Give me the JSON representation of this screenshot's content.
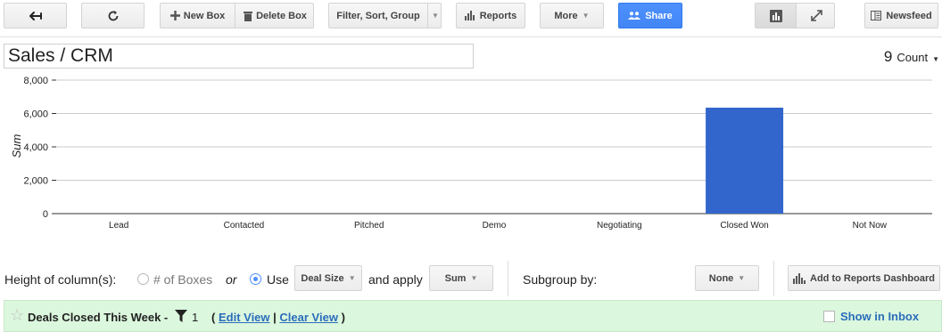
{
  "toolbar": {
    "back_icon": "arrow-left-icon",
    "refresh_icon": "refresh-icon",
    "new_box_label": "New Box",
    "delete_box_label": "Delete Box",
    "filter_label": "Filter, Sort, Group",
    "reports_label": "Reports",
    "more_label": "More",
    "share_label": "Share",
    "newsfeed_label": "Newsfeed",
    "accent_color": "#4285f4"
  },
  "pipeline": {
    "title": "Sales / CRM",
    "count_value": "9",
    "count_label": "Count"
  },
  "chart_data": {
    "type": "bar",
    "ylabel": "Sum",
    "xlabel": "",
    "ylim": [
      0,
      8000
    ],
    "yticks": [
      0,
      2000,
      4000,
      6000,
      8000
    ],
    "ytick_labels": [
      "0",
      "2,000",
      "4,000",
      "6,000",
      "8,000"
    ],
    "categories": [
      "Lead",
      "Contacted",
      "Pitched",
      "Demo",
      "Negotiating",
      "Closed Won",
      "Not Now"
    ],
    "values": [
      0,
      0,
      0,
      0,
      0,
      6350,
      0
    ],
    "grid": true,
    "bar_color": "#3366cc"
  },
  "controls": {
    "height_label": "Height of column(s):",
    "boxes_option": "# of Boxes",
    "or_text": "or",
    "use_option": "Use",
    "field_value": "Deal Size",
    "apply_text": "and apply",
    "agg_value": "Sum",
    "subgroup_label": "Subgroup by:",
    "subgroup_value": "None",
    "add_dashboard_label": "Add to Reports Dashboard"
  },
  "view": {
    "name": "Deals Closed This Week -",
    "filter_count": "1",
    "open_paren": "(",
    "edit_link": "Edit View",
    "separator": "|",
    "clear_link": "Clear View",
    "close_paren": ")",
    "show_in_inbox_label": "Show in Inbox",
    "background": "#dbf7dd"
  }
}
